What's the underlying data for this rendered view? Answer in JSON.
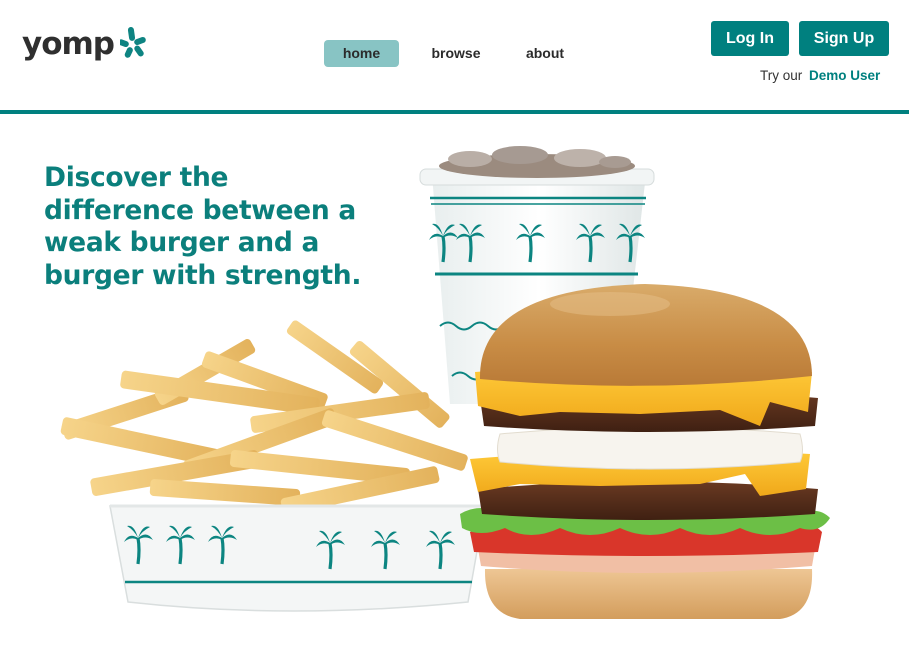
{
  "brand": {
    "name": "yomp",
    "icon": "burst-icon",
    "accent": "#00807f"
  },
  "nav": {
    "items": [
      {
        "label": "home",
        "active": true
      },
      {
        "label": "browse",
        "active": false
      },
      {
        "label": "about",
        "active": false
      }
    ]
  },
  "auth": {
    "login_label": "Log In",
    "signup_label": "Sign Up",
    "demo_prefix": "Try our",
    "demo_link": "Demo User"
  },
  "hero": {
    "headline": "Discover the difference between a weak burger and a burger with strength."
  },
  "colors": {
    "teal": "#00807f",
    "nav_active_bg": "#88c4c4",
    "headline": "#0b7f7c"
  }
}
